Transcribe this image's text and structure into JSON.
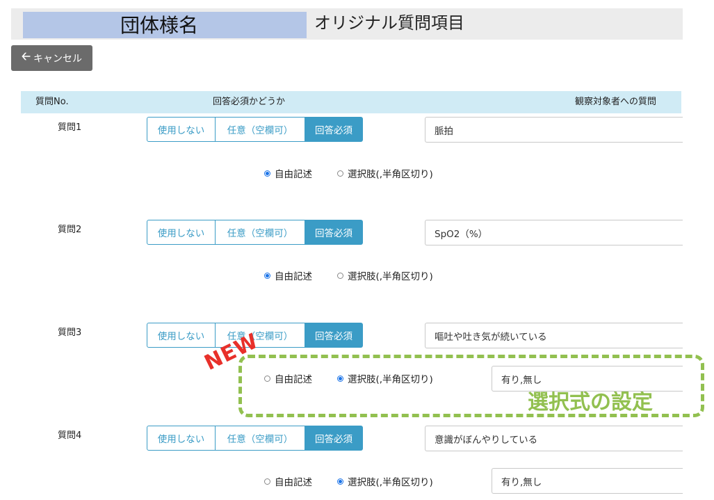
{
  "header": {
    "org_name": "団体様名",
    "page_title": "オリジナル質問項目"
  },
  "toolbar": {
    "cancel_label": "キャンセル",
    "cancel_icon": "arrow-left-icon"
  },
  "columns": {
    "no": "質問No.",
    "required": "回答必須かどうか",
    "question": "観察対象者への質問"
  },
  "options": {
    "unused": "使用しない",
    "optional": "任意（空欄可）",
    "required": "回答必須"
  },
  "radio_labels": {
    "free": "自由記述",
    "choice": "選択肢(,半角区切り)"
  },
  "questions": [
    {
      "label": "質問1",
      "text": "脈拍",
      "required_mode": "回答必須",
      "answer_type": "自由記述",
      "choices": ""
    },
    {
      "label": "質問2",
      "text": "SpO2（%）",
      "required_mode": "回答必須",
      "answer_type": "自由記述",
      "choices": ""
    },
    {
      "label": "質問3",
      "text": "嘔吐や吐き気が続いている",
      "required_mode": "回答必須",
      "answer_type": "選択肢(,半角区切り)",
      "choices": "有り,無し"
    },
    {
      "label": "質問4",
      "text": "意識がぼんやりしている",
      "required_mode": "回答必須",
      "answer_type": "選択肢(,半角区切り)",
      "choices": "有り,無し"
    }
  ],
  "annotations": {
    "new_badge": "NEW",
    "callout": "選択式の設定",
    "callout_color": "#92c050",
    "badge_color": "#e8302a"
  },
  "colors": {
    "accent": "#3b9cc6",
    "header_box": "#b4c6e7",
    "column_header": "#d0ebf5",
    "radio_selected": "#1a73e8"
  }
}
